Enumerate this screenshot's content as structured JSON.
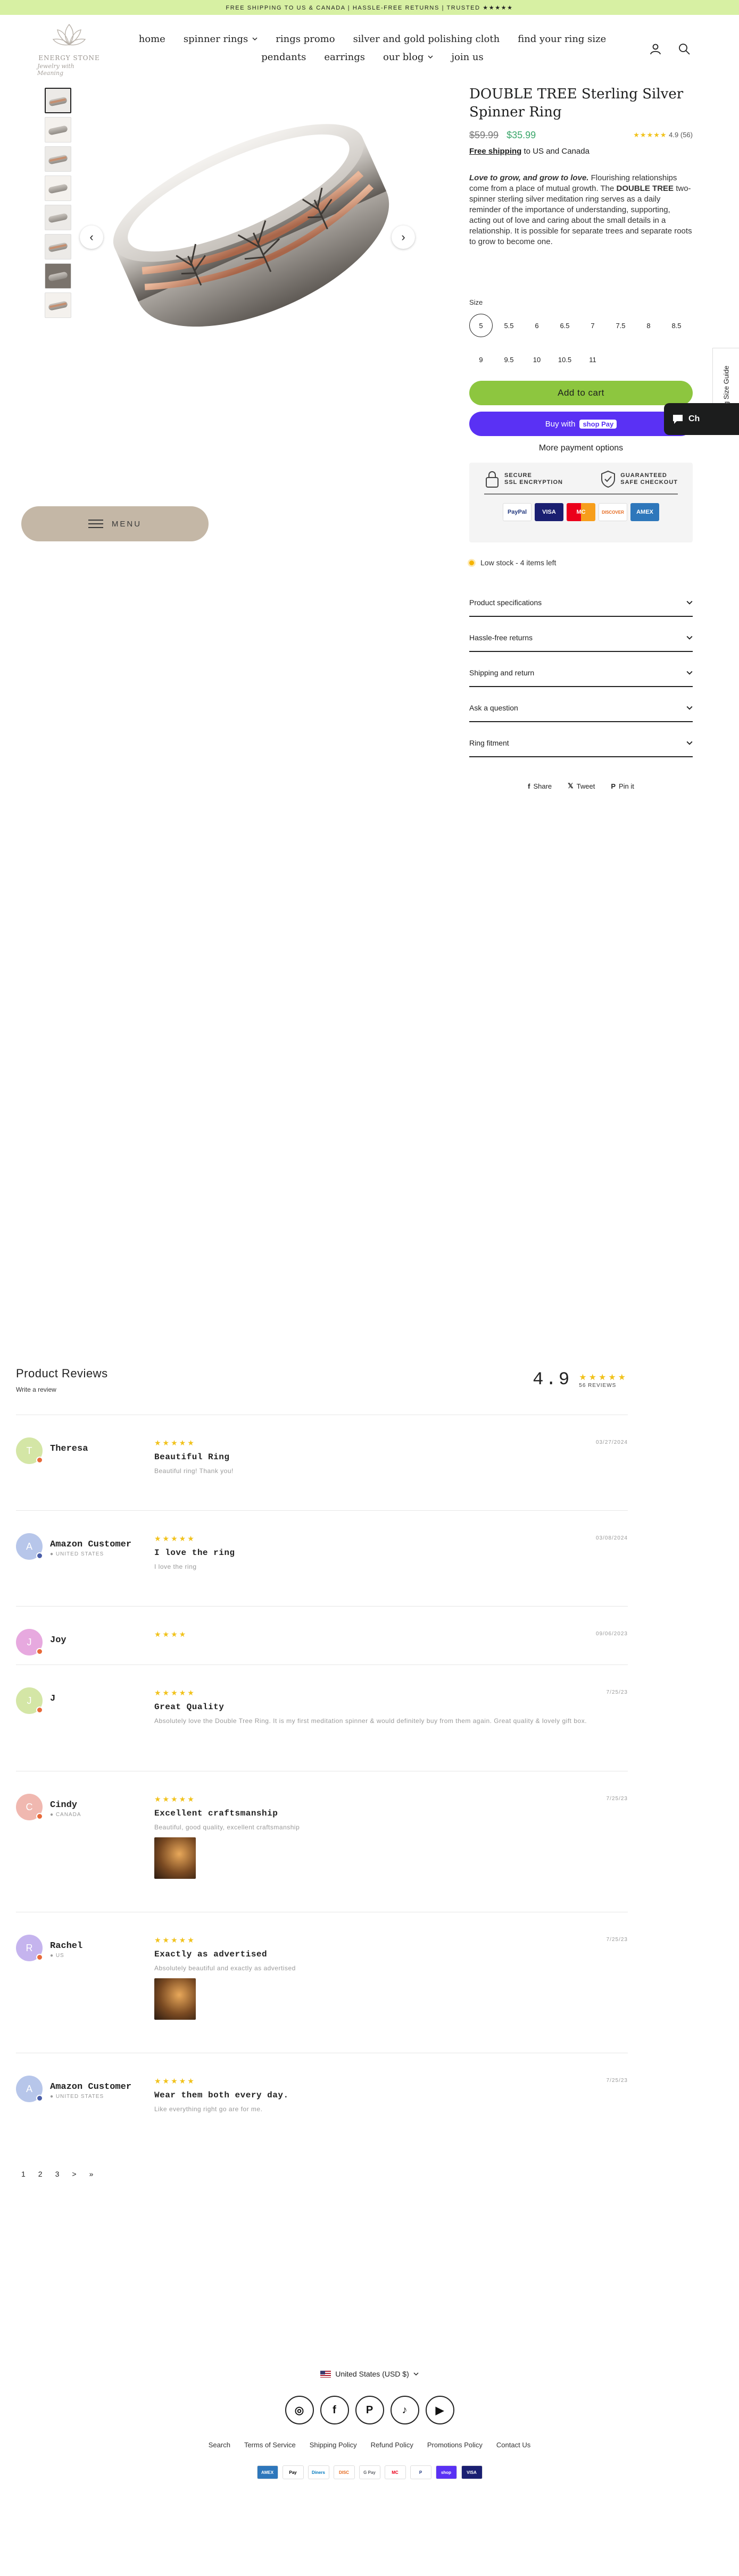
{
  "announcement": "FREE SHIPPING TO US & CANADA | HASSLE-FREE RETURNS | TRUSTED ★★★★★",
  "brand": {
    "name": "ENERGY STONE",
    "tagline": "Jewelry with Meaning"
  },
  "nav": {
    "row1": [
      {
        "label": "home",
        "dropdown": false
      },
      {
        "label": "spinner rings",
        "dropdown": true
      },
      {
        "label": "rings promo",
        "dropdown": false
      },
      {
        "label": "silver and gold polishing cloth",
        "dropdown": false
      },
      {
        "label": "find your ring size",
        "dropdown": false
      }
    ],
    "row2": [
      {
        "label": "pendants",
        "dropdown": false
      },
      {
        "label": "earrings",
        "dropdown": false
      },
      {
        "label": "our blog",
        "dropdown": true
      },
      {
        "label": "join us",
        "dropdown": false
      }
    ],
    "icons": [
      "account-icon",
      "search-icon"
    ]
  },
  "gallery": {
    "thumb_count": 8,
    "prev_icon": "‹",
    "next_icon": "›",
    "menu_label": "MENU"
  },
  "product": {
    "title": "DOUBLE TREE Sterling Silver Spinner Ring",
    "old_price": "$59.99",
    "price": "$35.99",
    "rating_stars": "★★★★★",
    "rating_value": "4.9",
    "rating_count": "(56)",
    "ship_bold": "Free shipping",
    "ship_rest": " to US and Canada",
    "desc_lead": "Love to grow, and grow to love.",
    "desc_1": " Flourishing relationships come from a place of mutual growth. The ",
    "desc_name": "DOUBLE TREE",
    "desc_2": " two-spinner sterling silver meditation ring serves as a daily reminder of the importance of understanding, supporting, acting out of love and caring about the small details in a relationship.  It is possible for separate trees and separate roots to grow to become one.",
    "size_label": "Size",
    "sizes": [
      "5",
      "5.5",
      "6",
      "6.5",
      "7",
      "7.5",
      "8",
      "8.5",
      "9",
      "9.5",
      "10",
      "10.5",
      "11"
    ],
    "selected_size": "5",
    "add_to_cart": "Add to cart",
    "buy_with": "Buy with",
    "shop_pay": "shop Pay",
    "more_payment": "More payment options",
    "secure_1": "SECURE\nSSL ENCRYPTION",
    "secure_2": "GUARANTEED\nSAFE CHECKOUT",
    "cards": [
      "PayPal",
      "VISA",
      "MC",
      "DISCOVER",
      "AMEX"
    ],
    "stock": "Low stock - 4 items left",
    "accordion": [
      "Product specifications",
      "Hassle-free returns",
      "Shipping and return",
      "Ask a question",
      "Ring fitment"
    ],
    "share": [
      "Share",
      "Tweet",
      "Pin it"
    ]
  },
  "side": {
    "size_guide": "Ring Size Guide",
    "chat": "Ch"
  },
  "reviews": {
    "title": "Product Reviews",
    "write": "Write a review",
    "score": "4.9",
    "score_stars": "★★★★★",
    "count_label": "56 REVIEWS",
    "items": [
      {
        "initial": "T",
        "name": "Theresa",
        "location": "",
        "stars": "★★★★★",
        "date": "03/27/2024",
        "title": "Beautiful Ring",
        "body": "Beautiful ring! Thank you!",
        "has_image": false,
        "avatar_color": "#d4e6a6",
        "badge_color": "#e86a3a"
      },
      {
        "initial": "A",
        "name": "Amazon Customer",
        "location": "● UNITED STATES",
        "stars": "★★★★★",
        "date": "03/08/2024",
        "title": "I love the ring",
        "body": "I love the ring",
        "has_image": false,
        "avatar_color": "#b7c6ea",
        "badge_color": "#4a5ea8"
      },
      {
        "initial": "J",
        "name": "Joy",
        "location": "",
        "stars": "★★★★",
        "date": "09/06/2023",
        "title": "",
        "body": "",
        "has_image": false,
        "avatar_color": "#e7a9df",
        "badge_color": "#e86a3a"
      },
      {
        "initial": "J",
        "name": "J",
        "location": "",
        "stars": "★★★★★",
        "date": "7/25/23",
        "title": "Great Quality",
        "body": "Absolutely love the Double Tree Ring. It is my first meditation spinner & would definitely buy from them again. Great quality & lovely gift box.",
        "has_image": false,
        "avatar_color": "#d4e6a6",
        "badge_color": "#e86a3a"
      },
      {
        "initial": "C",
        "name": "Cindy",
        "location": "● CANADA",
        "stars": "★★★★★",
        "date": "7/25/23",
        "title": "Excellent craftsmanship",
        "body": "Beautiful, good quality, excellent craftsmanship",
        "has_image": true,
        "avatar_color": "#f0b8b0",
        "badge_color": "#e86a3a"
      },
      {
        "initial": "R",
        "name": "Rachel",
        "location": "● US",
        "stars": "★★★★★",
        "date": "7/25/23",
        "title": "Exactly as advertised",
        "body": "Absolutely beautiful and exactly as advertised",
        "has_image": true,
        "avatar_color": "#c5b4ee",
        "badge_color": "#e86a3a"
      },
      {
        "initial": "A",
        "name": "Amazon Customer",
        "location": "● UNITED STATES",
        "stars": "★★★★★",
        "date": "7/25/23",
        "title": "Wear them both every day.",
        "body": "Like everything right go are for me.",
        "has_image": false,
        "avatar_color": "#b7c6ea",
        "badge_color": "#4a5ea8"
      }
    ],
    "pages": [
      "1",
      "2",
      "3",
      ">",
      "»"
    ]
  },
  "footer": {
    "currency": "United States (USD $)",
    "socials": [
      "instagram-icon",
      "facebook-icon",
      "pinterest-icon",
      "tiktok-icon",
      "youtube-icon"
    ],
    "social_glyphs": [
      "◎",
      "f",
      "P",
      "♪",
      "▶"
    ],
    "links": [
      "Search",
      "Terms of Service",
      "Shipping Policy",
      "Refund Policy",
      "Promotions Policy",
      "Contact Us"
    ],
    "pay": [
      "AMEX",
      "Pay",
      "Diners",
      "DISC",
      "G Pay",
      "MC",
      "P",
      "shop",
      "VISA"
    ]
  },
  "colors": {
    "accent_green": "#8dc63f",
    "shop_pay": "#5a31f4",
    "sale_price": "#3aa66a",
    "star": "#f1c21b",
    "announce_bg": "#d7f0a3"
  }
}
